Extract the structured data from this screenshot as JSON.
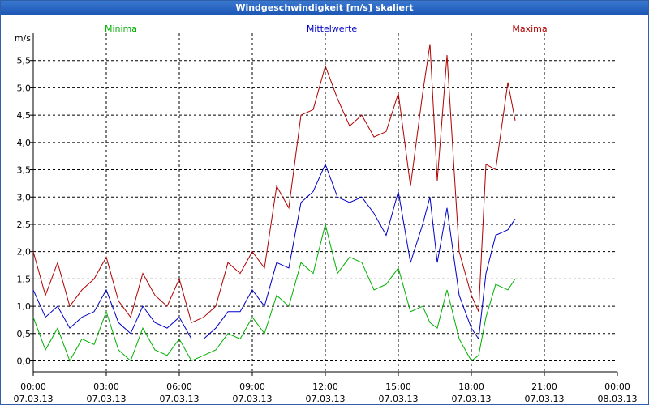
{
  "window": {
    "title": "Windgeschwindigkeit [m/s] skaliert"
  },
  "chart_data": {
    "type": "line",
    "title": "Windgeschwindigkeit [m/s] skaliert",
    "ylabel": "m/s",
    "ylim": [
      -0.2,
      6.0
    ],
    "yticks": [
      0.0,
      0.5,
      1.0,
      1.5,
      2.0,
      2.5,
      3.0,
      3.5,
      4.0,
      4.5,
      5.0,
      5.5
    ],
    "ytick_labels": [
      "0,0",
      "0,5",
      "1,0",
      "1,5",
      "2,0",
      "2,5",
      "3,0",
      "3,5",
      "4,0",
      "4,5",
      "5,0",
      "5,5"
    ],
    "xlim": [
      0,
      24
    ],
    "xticks": [
      0,
      3,
      6,
      9,
      12,
      15,
      18,
      21,
      24
    ],
    "xtick_labels": [
      [
        "00:00",
        "07.03.13"
      ],
      [
        "03:00",
        "07.03.13"
      ],
      [
        "06:00",
        "07.03.13"
      ],
      [
        "09:00",
        "07.03.13"
      ],
      [
        "12:00",
        "07.03.13"
      ],
      [
        "15:00",
        "07.03.13"
      ],
      [
        "18:00",
        "07.03.13"
      ],
      [
        "21:00",
        "07.03.13"
      ],
      [
        "00:00",
        "08.03.13"
      ]
    ],
    "grid": true,
    "legend": [
      {
        "name": "Minima",
        "color": "#00b000"
      },
      {
        "name": "Mittelwerte",
        "color": "#0000c8"
      },
      {
        "name": "Maxima",
        "color": "#b00000"
      }
    ],
    "series": [
      {
        "name": "Maxima",
        "color": "#b00000",
        "x": [
          0.0,
          0.5,
          1.0,
          1.5,
          2.0,
          2.5,
          3.0,
          3.5,
          4.0,
          4.5,
          5.0,
          5.5,
          6.0,
          6.5,
          7.0,
          7.5,
          8.0,
          8.5,
          9.0,
          9.5,
          10.0,
          10.5,
          11.0,
          11.5,
          12.0,
          12.5,
          13.0,
          13.5,
          14.0,
          14.5,
          15.0,
          15.5,
          16.0,
          16.3,
          16.6,
          17.0,
          17.5,
          18.0,
          18.3,
          18.6,
          19.0,
          19.5,
          19.8
        ],
        "y": [
          2.0,
          1.2,
          1.8,
          1.0,
          1.3,
          1.5,
          1.9,
          1.1,
          0.8,
          1.6,
          1.2,
          1.0,
          1.5,
          0.7,
          0.8,
          1.0,
          1.8,
          1.6,
          2.0,
          1.7,
          3.2,
          2.8,
          4.5,
          4.6,
          5.4,
          4.8,
          4.3,
          4.5,
          4.1,
          4.2,
          4.9,
          3.2,
          4.9,
          5.8,
          3.3,
          5.6,
          2.0,
          1.2,
          0.9,
          3.6,
          3.5,
          5.1,
          4.4
        ],
        "values_note": ""
      },
      {
        "name": "Mittelwerte",
        "color": "#0000c8",
        "x": [
          0.0,
          0.5,
          1.0,
          1.5,
          2.0,
          2.5,
          3.0,
          3.5,
          4.0,
          4.5,
          5.0,
          5.5,
          6.0,
          6.5,
          7.0,
          7.5,
          8.0,
          8.5,
          9.0,
          9.5,
          10.0,
          10.5,
          11.0,
          11.5,
          12.0,
          12.5,
          13.0,
          13.5,
          14.0,
          14.5,
          15.0,
          15.5,
          16.0,
          16.3,
          16.6,
          17.0,
          17.5,
          18.0,
          18.3,
          18.6,
          19.0,
          19.5,
          19.8
        ],
        "y": [
          1.3,
          0.8,
          1.0,
          0.6,
          0.8,
          0.9,
          1.3,
          0.7,
          0.5,
          1.0,
          0.7,
          0.6,
          0.8,
          0.4,
          0.4,
          0.6,
          0.9,
          0.9,
          1.3,
          1.0,
          1.8,
          1.7,
          2.9,
          3.1,
          3.6,
          3.0,
          2.9,
          3.0,
          2.7,
          2.3,
          3.1,
          1.8,
          2.5,
          3.0,
          1.8,
          2.8,
          1.2,
          0.6,
          0.4,
          1.6,
          2.3,
          2.4,
          2.6
        ]
      },
      {
        "name": "Minima",
        "color": "#00b000",
        "x": [
          0.0,
          0.5,
          1.0,
          1.5,
          2.0,
          2.5,
          3.0,
          3.5,
          4.0,
          4.5,
          5.0,
          5.5,
          6.0,
          6.5,
          7.0,
          7.5,
          8.0,
          8.5,
          9.0,
          9.5,
          10.0,
          10.5,
          11.0,
          11.5,
          12.0,
          12.5,
          13.0,
          13.5,
          14.0,
          14.5,
          15.0,
          15.5,
          16.0,
          16.3,
          16.6,
          17.0,
          17.5,
          18.0,
          18.3,
          18.6,
          19.0,
          19.5,
          19.8
        ],
        "y": [
          0.8,
          0.2,
          0.6,
          0.0,
          0.4,
          0.3,
          0.9,
          0.2,
          0.0,
          0.6,
          0.2,
          0.1,
          0.4,
          0.0,
          0.1,
          0.2,
          0.5,
          0.4,
          0.8,
          0.5,
          1.2,
          1.0,
          1.8,
          1.6,
          2.5,
          1.6,
          1.9,
          1.8,
          1.3,
          1.4,
          1.7,
          0.9,
          1.0,
          0.7,
          0.6,
          1.3,
          0.4,
          0.0,
          0.1,
          0.8,
          1.4,
          1.3,
          1.5
        ]
      }
    ]
  }
}
